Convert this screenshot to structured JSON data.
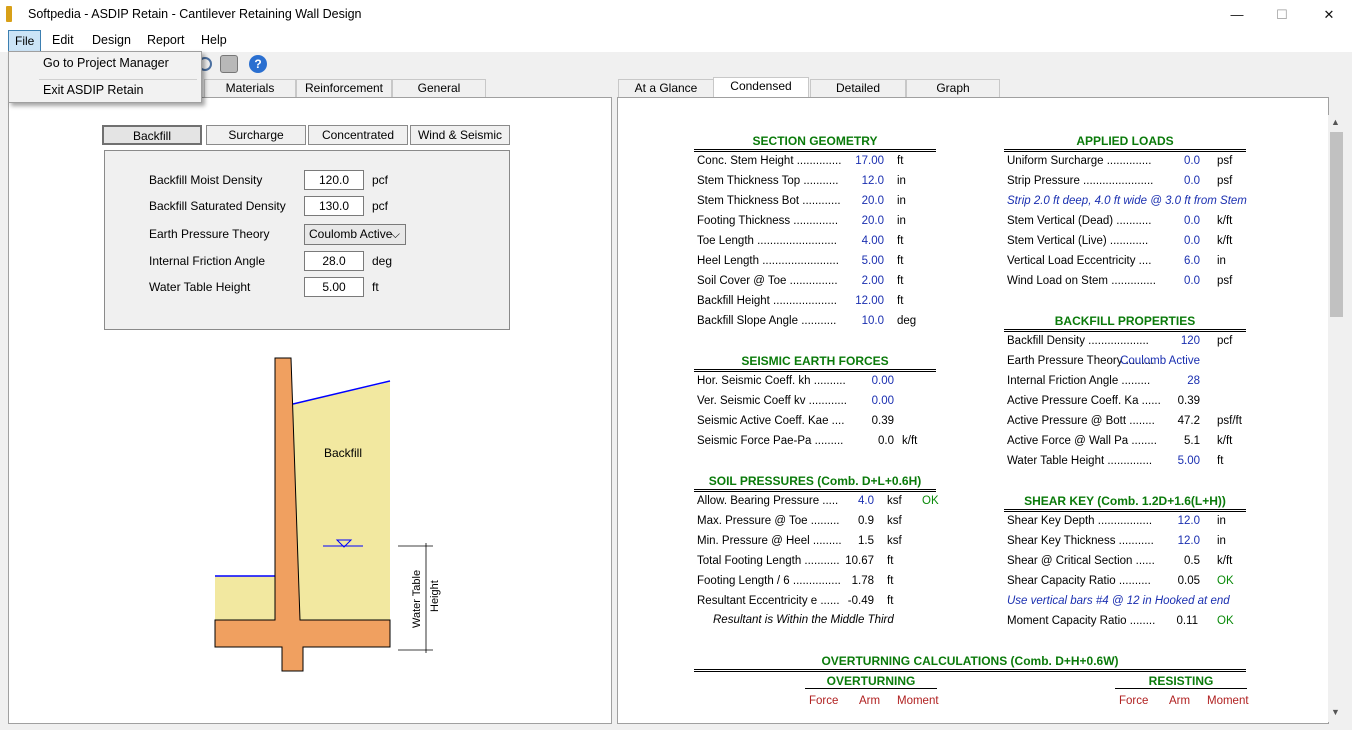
{
  "window": {
    "title": "Softpedia - ASDIP Retain - Cantilever Retaining Wall Design",
    "minimize": "—",
    "maximize": "☐",
    "close": "✕"
  },
  "menu": {
    "file": "File",
    "edit": "Edit",
    "design": "Design",
    "report": "Report",
    "help": "Help"
  },
  "file_menu": {
    "item1": "Go to Project Manager",
    "item2": "Exit ASDIP Retain"
  },
  "left_tabs": {
    "materials": "Materials",
    "reinforcement": "Reinforcement",
    "general": "General"
  },
  "sub_tabs": {
    "backfill": "Backfill",
    "surcharge": "Surcharge",
    "concentrated": "Concentrated",
    "wind": "Wind & Seismic"
  },
  "inputs": {
    "moist_label": "Backfill Moist Density",
    "moist_value": "120.0",
    "moist_unit": "pcf",
    "sat_label": "Backfill Saturated Density",
    "sat_value": "130.0",
    "sat_unit": "pcf",
    "theory_label": "Earth Pressure Theory",
    "theory_value": "Coulomb Active",
    "friction_label": "Internal Friction Angle",
    "friction_value": "28.0",
    "friction_unit": "deg",
    "water_label": "Water Table Height",
    "water_value": "5.00",
    "water_unit": "ft"
  },
  "diagram": {
    "backfill": "Backfill",
    "water_table": "Water Table",
    "height": "Height"
  },
  "right_tabs": {
    "glance": "At a Glance",
    "condensed": "Condensed",
    "detailed": "Detailed",
    "graph": "Graph"
  },
  "section_geometry": {
    "title": "SECTION GEOMETRY",
    "rows": [
      {
        "label": "Conc. Stem Height ..............",
        "value": "17.00",
        "unit": "ft"
      },
      {
        "label": "Stem Thickness Top  ...........",
        "value": "12.0",
        "unit": "in"
      },
      {
        "label": "Stem Thickness Bot  ............",
        "value": "20.0",
        "unit": "in"
      },
      {
        "label": "Footing Thickness  ..............",
        "value": "20.0",
        "unit": "in"
      },
      {
        "label": "Toe Length  .........................",
        "value": "4.00",
        "unit": "ft"
      },
      {
        "label": "Heel Length  ........................",
        "value": "5.00",
        "unit": "ft"
      },
      {
        "label": "Soil Cover @ Toe  ...............",
        "value": "2.00",
        "unit": "ft"
      },
      {
        "label": "Backfill Height  ....................",
        "value": "12.00",
        "unit": "ft"
      },
      {
        "label": "Backfill Slope Angle  ...........",
        "value": "10.0",
        "unit": "deg"
      }
    ]
  },
  "seismic": {
    "title": "SEISMIC EARTH FORCES",
    "rows": [
      {
        "label": "Hor. Seismic Coeff. kh  ..........",
        "value": "0.00",
        "unit": ""
      },
      {
        "label": "Ver. Seismic Coeff kv  ............",
        "value": "0.00",
        "unit": ""
      },
      {
        "label": "Seismic Active Coeff. Kae  ....",
        "value": "0.39",
        "unit": ""
      },
      {
        "label": "Seismic Force Pae-Pa  .........",
        "value": "0.0",
        "unit": "k/ft"
      }
    ]
  },
  "soil": {
    "title": "SOIL PRESSURES  (Comb. D+L+0.6H)",
    "rows": [
      {
        "label": "Allow. Bearing Pressure  .....",
        "value": "4.0",
        "unit": "ksf",
        "ok": "OK"
      },
      {
        "label": "Max. Pressure @ Toe  .........",
        "value": "0.9",
        "unit": "ksf",
        "ok": ""
      },
      {
        "label": "Min. Pressure @ Heel  .........",
        "value": "1.5",
        "unit": "ksf",
        "ok": ""
      },
      {
        "label": "Total Footing Length  ...........",
        "value": "10.67",
        "unit": "ft",
        "ok": ""
      },
      {
        "label": "Footing Length / 6  ...............",
        "value": "1.78",
        "unit": "ft",
        "ok": ""
      },
      {
        "label": "Resultant Eccentricity e  ......",
        "value": "-0.49",
        "unit": "ft",
        "ok": ""
      }
    ],
    "note": "Resultant is Within the Middle Third"
  },
  "applied": {
    "title": "APPLIED LOADS",
    "rows": [
      {
        "label": "Uniform Surcharge  ..............",
        "value": "0.0",
        "unit": "psf"
      },
      {
        "label": "Strip Pressure  ......................",
        "value": "0.0",
        "unit": "psf"
      },
      {
        "label": "Stem Vertical (Dead)  ...........",
        "value": "0.0",
        "unit": "k/ft"
      },
      {
        "label": "Stem Vertical (Live)  ............",
        "value": "0.0",
        "unit": "k/ft"
      },
      {
        "label": "Vertical Load Eccentricity  ....",
        "value": "6.0",
        "unit": "in"
      },
      {
        "label": "Wind Load on Stem  ..............",
        "value": "0.0",
        "unit": "psf"
      }
    ],
    "note": "Strip 2.0 ft deep,  4.0 ft wide @ 3.0 ft from Stem"
  },
  "backfill_props": {
    "title": "BACKFILL PROPERTIES",
    "rows": [
      {
        "label": "Backfill Density  ...................",
        "value": "120",
        "unit": "pcf"
      },
      {
        "label": "Earth Pressure Theory  .........",
        "value": "Coulomb Active",
        "unit": ""
      },
      {
        "label": "Internal Friction Angle  .........",
        "value": "28",
        "unit": ""
      },
      {
        "label": "Active Pressure Coeff. Ka  ......",
        "value": "0.39",
        "unit": ""
      },
      {
        "label": "Active Pressure @ Bott  ........",
        "value": "47.2",
        "unit": "psf/ft"
      },
      {
        "label": "Active Force @ Wall Pa  ........",
        "value": "5.1",
        "unit": "k/ft"
      },
      {
        "label": "Water Table Height  ..............",
        "value": "5.00",
        "unit": "ft"
      }
    ]
  },
  "shear_key": {
    "title": "SHEAR KEY (Comb. 1.2D+1.6(L+H))",
    "rows": [
      {
        "label": "Shear Key Depth  .................",
        "value": "12.0",
        "unit": "in",
        "ok": ""
      },
      {
        "label": "Shear Key Thickness  ...........",
        "value": "12.0",
        "unit": "in",
        "ok": ""
      },
      {
        "label": "Shear @ Critical Section  ......",
        "value": "0.5",
        "unit": "k/ft",
        "ok": ""
      },
      {
        "label": "Shear Capacity Ratio  ..........",
        "value": "0.05",
        "unit": "",
        "ok": "OK"
      }
    ],
    "note": "Use vertical bars  #4 @ 12 in Hooked at end",
    "moment_label": "Moment Capacity Ratio  ........",
    "moment_value": "0.11",
    "moment_ok": "OK"
  },
  "overturning": {
    "title": "OVERTURNING CALCULATIONS (Comb. D+H+0.6W)",
    "left": "OVERTURNING",
    "right": "RESISTING",
    "force": "Force",
    "arm": "Arm",
    "moment": "Moment"
  },
  "colors": {
    "concrete": "#f0a060",
    "soil": "#f2e8a0",
    "water": "#0000ff",
    "section_title": "#0a7a0a",
    "value_blue": "#1a2fb0"
  }
}
